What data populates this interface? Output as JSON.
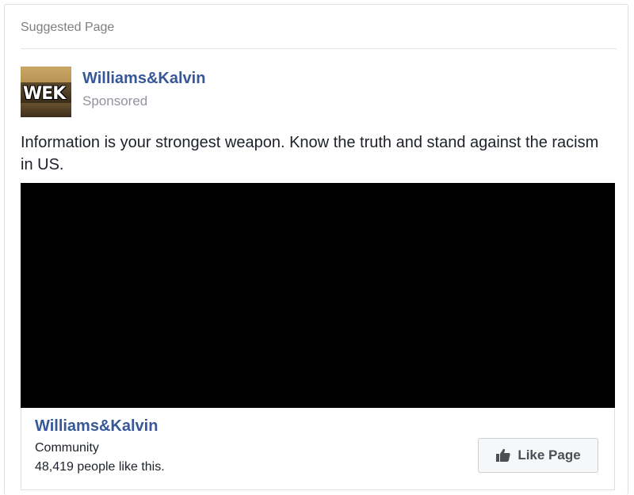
{
  "header": {
    "title": "Suggested Page"
  },
  "post": {
    "avatar_text": "WEK",
    "page_name": "Williams&Kalvin",
    "sponsored_label": "Sponsored",
    "text": "Information is your strongest weapon. Know the truth and stand against the racism in US."
  },
  "footer": {
    "page_name": "Williams&Kalvin",
    "category": "Community",
    "likes": "48,419 people like this.",
    "like_button_label": "Like Page"
  },
  "colors": {
    "link": "#365899",
    "muted": "#90949c",
    "text": "#1d2129",
    "media_bg": "#000000"
  },
  "icons": {
    "like_button": "thumbs-up-icon"
  }
}
